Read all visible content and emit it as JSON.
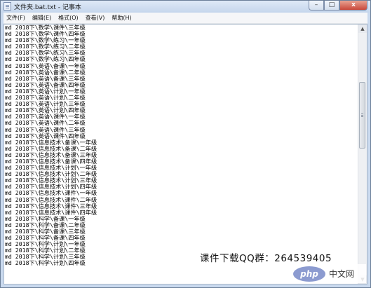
{
  "window": {
    "title": "文件夹.bat.txt - 记事本",
    "buttons": {
      "minimize": "–",
      "maximize": "□",
      "close": "x"
    }
  },
  "menu": [
    "文件(F)",
    "编辑(E)",
    "格式(O)",
    "查看(V)",
    "帮助(H)"
  ],
  "editor": {
    "lines": [
      "md 2018下\\数学\\课件\\三年级",
      "md 2018下\\数学\\课件\\四年级",
      "md 2018下\\数学\\练习\\一年级",
      "md 2018下\\数学\\练习\\二年级",
      "md 2018下\\数学\\练习\\三年级",
      "md 2018下\\数学\\练习\\四年级",
      "md 2018下\\英语\\备课\\一年级",
      "md 2018下\\英语\\备课\\二年级",
      "md 2018下\\英语\\备课\\三年级",
      "md 2018下\\英语\\备课\\四年级",
      "md 2018下\\英语\\计划\\一年级",
      "md 2018下\\英语\\计划\\二年级",
      "md 2018下\\英语\\计划\\三年级",
      "md 2018下\\英语\\计划\\四年级",
      "md 2018下\\英语\\课件\\一年级",
      "md 2018下\\英语\\课件\\二年级",
      "md 2018下\\英语\\课件\\三年级",
      "md 2018下\\英语\\课件\\四年级",
      "md 2018下\\信息技术\\备课\\一年级",
      "md 2018下\\信息技术\\备课\\二年级",
      "md 2018下\\信息技术\\备课\\三年级",
      "md 2018下\\信息技术\\备课\\四年级",
      "md 2018下\\信息技术\\计划\\一年级",
      "md 2018下\\信息技术\\计划\\二年级",
      "md 2018下\\信息技术\\计划\\三年级",
      "md 2018下\\信息技术\\计划\\四年级",
      "md 2018下\\信息技术\\课件\\一年级",
      "md 2018下\\信息技术\\课件\\二年级",
      "md 2018下\\信息技术\\课件\\三年级",
      "md 2018下\\信息技术\\课件\\四年级",
      "md 2018下\\科学\\备课\\一年级",
      "md 2018下\\科学\\备课\\二年级",
      "md 2018下\\科学\\备课\\三年级",
      "md 2018下\\科学\\备课\\四年级",
      "md 2018下\\科学\\计划\\一年级",
      "md 2018下\\科学\\计划\\二年级",
      "md 2018下\\科学\\计划\\三年级",
      "md 2018下\\科学\\计划\\四年级"
    ]
  },
  "scrollbar": {
    "up": "▲",
    "down": "▼"
  },
  "overlay": {
    "qq_text": "课件下载QQ群：264539405",
    "logo_badge": "php",
    "logo_text": "中文网"
  },
  "colors": {
    "title_gradient_top": "#dfe9f7",
    "close_button": "#c9483a",
    "php_badge": "#8c9bd0"
  }
}
